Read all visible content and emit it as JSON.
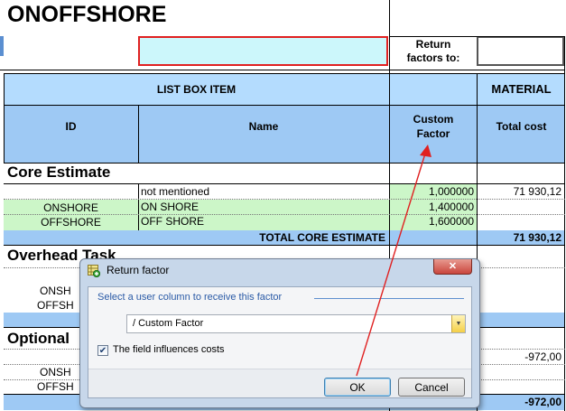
{
  "sheet": {
    "title": "ONOFFSHORE",
    "return_label": "Return\nfactors to:",
    "header": {
      "list_box_item": "LIST BOX ITEM",
      "material": "MATERIAL",
      "id": "ID",
      "name": "Name",
      "custom_factor": "Custom\nFactor",
      "total_cost": "Total cost"
    },
    "core": {
      "title": "Core Estimate",
      "rows": [
        {
          "id": "",
          "name": "not mentioned",
          "factor": "1,000000",
          "cost": "71 930,12"
        },
        {
          "id": "ONSHORE",
          "name": "ON SHORE",
          "factor": "1,400000",
          "cost": ""
        },
        {
          "id": "OFFSHORE",
          "name": "OFF SHORE",
          "factor": "1,600000",
          "cost": ""
        }
      ],
      "total_label": "TOTAL CORE ESTIMATE",
      "total_value": "71 930,12"
    },
    "overhead": {
      "title": "Overhead Task",
      "row1_id": "ONSH",
      "row2_id": "OFFSH"
    },
    "optional": {
      "title": "Optional",
      "cost1": "-972,00",
      "row1_id": "ONSH",
      "row2_id": "OFFSH",
      "total_value": "-972,00"
    }
  },
  "dialog": {
    "title": "Return factor",
    "group_label": "Select a user column to receive this factor",
    "select_value": "/ Custom Factor",
    "checkbox_label": "The field influences costs",
    "checkbox_checked": true,
    "ok_label": "OK",
    "cancel_label": "Cancel"
  },
  "colors": {
    "header_blue_dark": "#9ec9f4",
    "header_blue_light": "#b4dcfe",
    "factor_green": "#ccf6c8",
    "red_outline": "#e02020",
    "close_button": "#c9463d"
  }
}
